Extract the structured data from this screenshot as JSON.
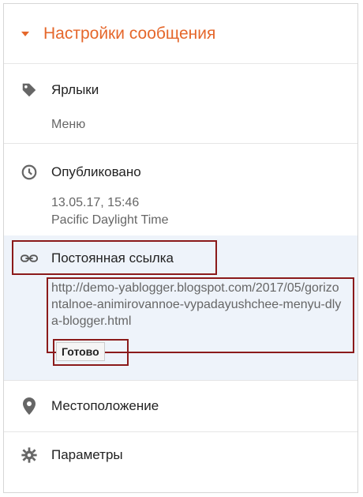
{
  "header": {
    "title": "Настройки сообщения"
  },
  "labels": {
    "title": "Ярлыки",
    "value": "Меню"
  },
  "published": {
    "title": "Опубликовано",
    "date": "13.05.17, 15:46",
    "timezone": "Pacific Daylight Time"
  },
  "permalink": {
    "title": "Постоянная ссылка",
    "url": "http://demo-yablogger.blogspot.com/2017/05/gorizontalnoe-animirovannoe-vypadayushchee-menyu-dlya-blogger.html",
    "done_label": "Готово"
  },
  "location": {
    "title": "Местоположение"
  },
  "params": {
    "title": "Параметры"
  },
  "colors": {
    "accent": "#e5672b",
    "highlight": "#8b1a1a",
    "panel": "#eef3fa"
  },
  "icons": [
    "label-icon",
    "clock-icon",
    "link-icon",
    "location-pin-icon",
    "gear-icon"
  ]
}
